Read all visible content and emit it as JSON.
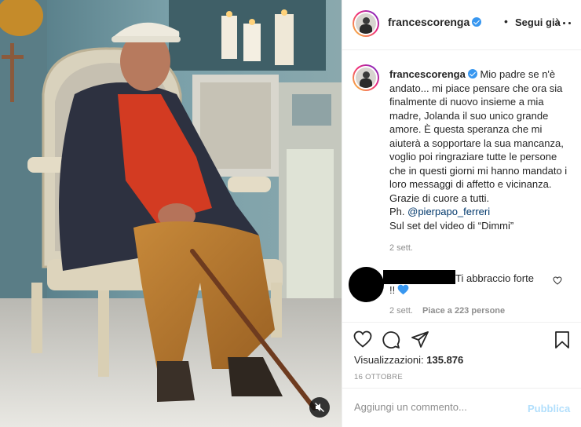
{
  "header": {
    "username": "francescorenga",
    "dot": "•",
    "follow_label": "Segui già"
  },
  "caption": {
    "username": "francescorenga",
    "text": " Mio padre se n'è andato... mi piace pensare che ora sia finalmente di nuovo insieme a mia madre, Jolanda il suo unico grande amore. È questa speranza che mi aiuterà a sopportare la sua mancanza, voglio poi ringraziare tutte le persone che in questi giorni mi hanno mandato i loro messaggi di affetto e vicinanza. Grazie di cuore a tutti.",
    "photo_prefix": "Ph. ",
    "mention": "@pierpapo_ferreri",
    "set_line": "Sul set del video di “Dimmi”",
    "time": "2 sett."
  },
  "comment": {
    "text_line1": "Ti abbraccio forte",
    "text_line2": "!!",
    "time": "2 sett.",
    "likes": "Piace a 223 persone"
  },
  "stats": {
    "views_label": "Visualizzazioni: ",
    "views_value": "135.876",
    "date": "16 OTTOBRE"
  },
  "composer": {
    "placeholder": "Aggiungi un commento...",
    "publish_label": "Pubblica"
  },
  "colors": {
    "link": "#00376b",
    "publish_disabled": "#b2dffc",
    "verified": "#3897f0",
    "heart": "#3897f0"
  },
  "icons": [
    "verified-badge-icon",
    "more-options-icon",
    "like-icon",
    "comment-icon",
    "share-icon",
    "save-icon",
    "heart-outline-icon",
    "blue-heart-icon",
    "mute-icon"
  ]
}
